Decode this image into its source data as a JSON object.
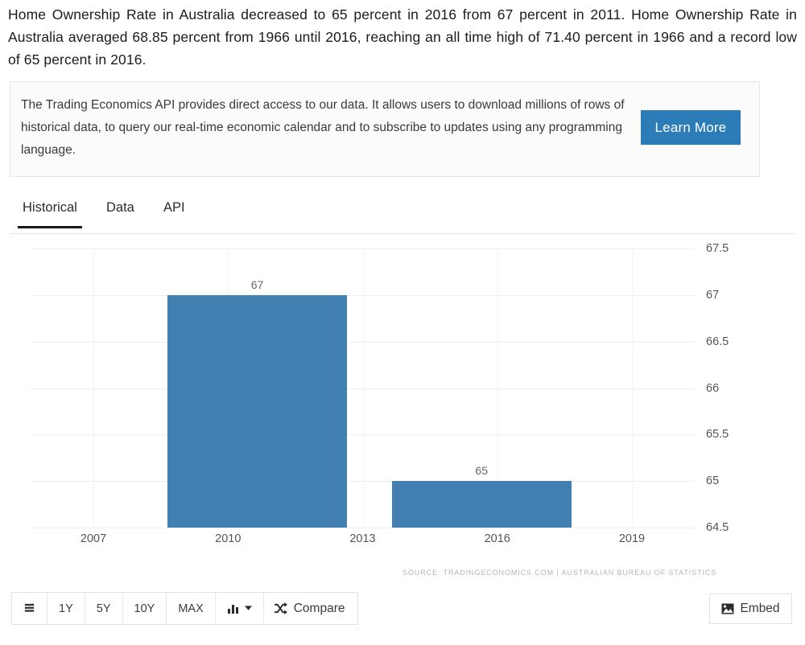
{
  "intro": {
    "text": "Home Ownership Rate in Australia decreased to 65 percent in 2016 from 67 percent in 2011. Home Ownership Rate in Australia averaged 68.85 percent from 1966 until 2016, reaching an all time high of 71.40 percent in 1966 and a record low of 65 percent in 2016."
  },
  "api_box": {
    "text": "The Trading Economics API provides direct access to our data. It allows users to download millions of rows of historical data, to query our real-time economic calendar and to subscribe to updates using any programming language.",
    "button_label": "Learn More",
    "button_color": "#2c7cb8"
  },
  "tabs": [
    {
      "label": "Historical",
      "active": true
    },
    {
      "label": "Data",
      "active": false
    },
    {
      "label": "API",
      "active": false
    }
  ],
  "toolbar": {
    "list_icon": "list-icon",
    "ranges": [
      "1Y",
      "5Y",
      "10Y",
      "MAX"
    ],
    "chart_type_icon": "bar-chart-icon",
    "chart_type_caret": "chevron-down-icon",
    "compare_icon": "shuffle-icon",
    "compare_label": "Compare",
    "embed_icon": "image-icon",
    "embed_label": "Embed"
  },
  "chart_data": {
    "type": "bar",
    "title": "",
    "xlabel": "",
    "ylabel": "",
    "categories": [
      "2011",
      "2016"
    ],
    "values": [
      67,
      65
    ],
    "data_labels": [
      "67",
      "65"
    ],
    "bar_color": "#4180b0",
    "ylim": [
      64.5,
      67.5
    ],
    "yticks": [
      67.5,
      67,
      66.5,
      66,
      65.5,
      65,
      64.5
    ],
    "ytick_labels": [
      "67.5",
      "67",
      "66.5",
      "66",
      "65.5",
      "65",
      "64.5"
    ],
    "xticks": [
      2007,
      2010,
      2013,
      2016,
      2019
    ],
    "xtick_labels": [
      "2007",
      "2010",
      "2013",
      "2016",
      "2019"
    ],
    "xlim": [
      2005.6,
      2020.4
    ],
    "grid": true,
    "legend": false,
    "source": "SOURCE: TRADINGECONOMICS.COM  |  AUSTRALIAN BUREAU OF STATISTICS"
  }
}
